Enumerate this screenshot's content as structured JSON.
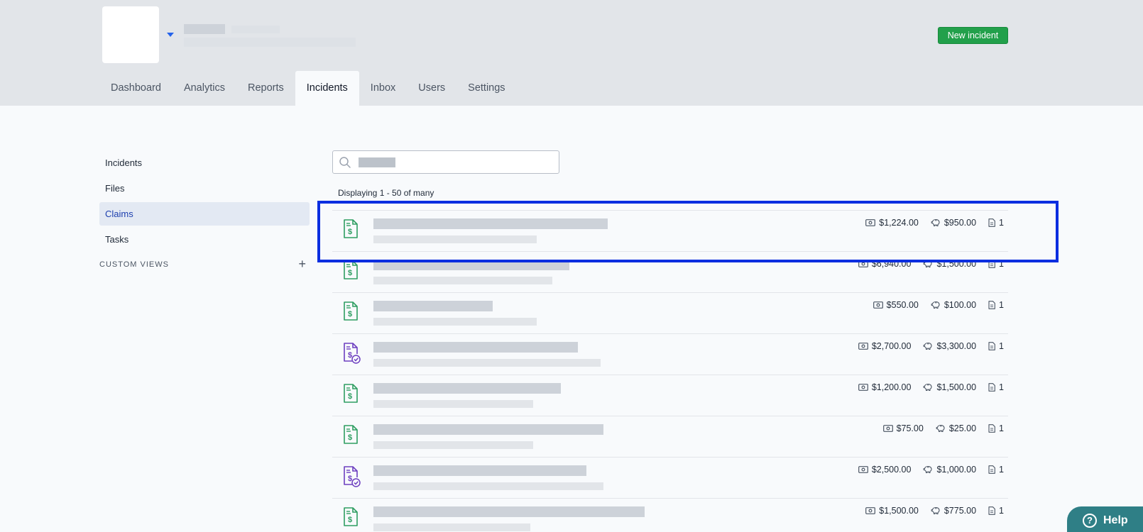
{
  "header": {
    "new_incident_label": "New incident"
  },
  "tabs": [
    {
      "label": "Dashboard"
    },
    {
      "label": "Analytics"
    },
    {
      "label": "Reports"
    },
    {
      "label": "Incidents"
    },
    {
      "label": "Inbox"
    },
    {
      "label": "Users"
    },
    {
      "label": "Settings"
    }
  ],
  "active_tab": "Incidents",
  "sidebar": {
    "items": [
      {
        "label": "Incidents"
      },
      {
        "label": "Files"
      },
      {
        "label": "Claims"
      },
      {
        "label": "Tasks"
      }
    ],
    "active_item": "Claims",
    "custom_views_label": "CUSTOM VIEWS"
  },
  "search": {
    "placeholder": "",
    "value": ""
  },
  "list": {
    "count_label": "Displaying 1 - 50 of many",
    "rows": [
      {
        "icon": "claim-document-dollar-icon",
        "status": "open",
        "amount": "$1,224.00",
        "reserve": "$950.00",
        "files": "1"
      },
      {
        "icon": "claim-document-dollar-icon",
        "status": "open",
        "amount": "$6,940.00",
        "reserve": "$1,500.00",
        "files": "1"
      },
      {
        "icon": "claim-document-dollar-icon",
        "status": "open",
        "amount": "$550.00",
        "reserve": "$100.00",
        "files": "1"
      },
      {
        "icon": "claim-document-dollar-check-icon",
        "status": "closed",
        "amount": "$2,700.00",
        "reserve": "$3,300.00",
        "files": "1"
      },
      {
        "icon": "claim-document-dollar-icon",
        "status": "open",
        "amount": "$1,200.00",
        "reserve": "$1,500.00",
        "files": "1"
      },
      {
        "icon": "claim-document-dollar-icon",
        "status": "open",
        "amount": "$75.00",
        "reserve": "$25.00",
        "files": "1"
      },
      {
        "icon": "claim-document-dollar-check-icon",
        "status": "closed",
        "amount": "$2,500.00",
        "reserve": "$1,000.00",
        "files": "1"
      },
      {
        "icon": "claim-document-dollar-icon",
        "status": "open",
        "amount": "$1,500.00",
        "reserve": "$775.00",
        "files": "1"
      }
    ]
  },
  "help": {
    "label": "Help"
  },
  "colors": {
    "open_icon": "#2f9e62",
    "closed_icon": "#6d3fc0",
    "primary_button": "#22a04b",
    "highlight_box": "#0b2ee0",
    "help_button": "#2f7f86"
  }
}
